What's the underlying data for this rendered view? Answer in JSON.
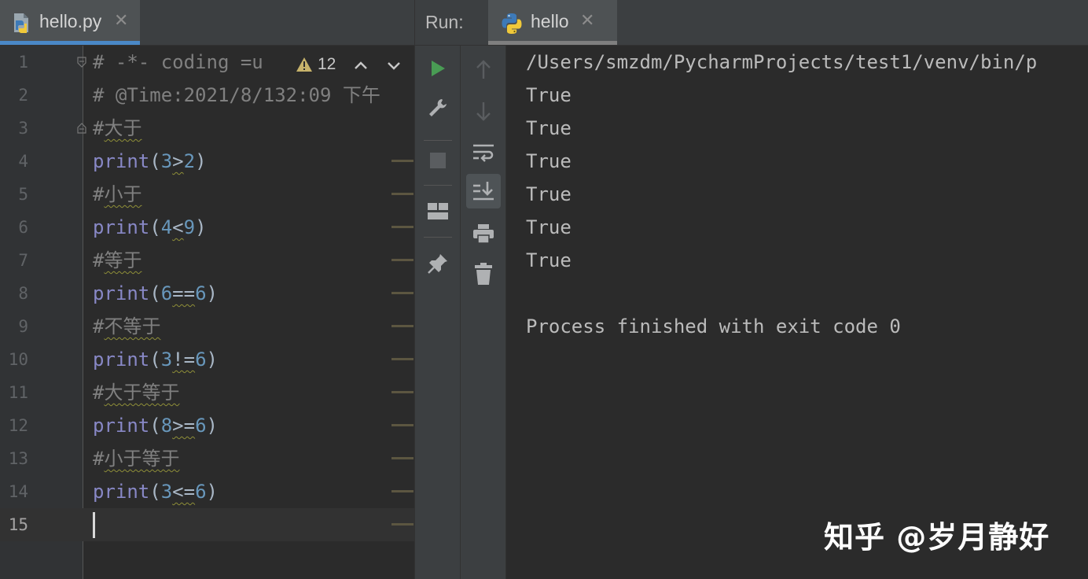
{
  "editor": {
    "tab": {
      "label": "hello.py",
      "close": "✕"
    },
    "inspection": {
      "warning_count": "12"
    },
    "line_numbers": [
      "1",
      "2",
      "3",
      "4",
      "5",
      "6",
      "7",
      "8",
      "9",
      "10",
      "11",
      "12",
      "13",
      "14",
      "15"
    ],
    "active_line": "15",
    "lines": [
      [
        {
          "t": "# -*- coding =u",
          "c": "comment"
        }
      ],
      [
        {
          "t": "# @Time:2021/8/132:09 下午",
          "c": "comment"
        }
      ],
      [
        {
          "t": "#",
          "c": "comment"
        },
        {
          "t": "大于",
          "c": "comment squiggle"
        }
      ],
      [
        {
          "t": "print",
          "c": "fn"
        },
        {
          "t": "(",
          "c": "paren"
        },
        {
          "t": "3",
          "c": "num"
        },
        {
          "t": ">",
          "c": "op squiggle"
        },
        {
          "t": "2",
          "c": "num"
        },
        {
          "t": ")",
          "c": "paren"
        }
      ],
      [
        {
          "t": "#",
          "c": "comment"
        },
        {
          "t": "小于",
          "c": "comment squiggle"
        }
      ],
      [
        {
          "t": "print",
          "c": "fn"
        },
        {
          "t": "(",
          "c": "paren"
        },
        {
          "t": "4",
          "c": "num"
        },
        {
          "t": "<",
          "c": "op squiggle"
        },
        {
          "t": "9",
          "c": "num"
        },
        {
          "t": ")",
          "c": "paren"
        }
      ],
      [
        {
          "t": "#",
          "c": "comment"
        },
        {
          "t": "等于",
          "c": "comment squiggle"
        }
      ],
      [
        {
          "t": "print",
          "c": "fn"
        },
        {
          "t": "(",
          "c": "paren"
        },
        {
          "t": "6",
          "c": "num"
        },
        {
          "t": "==",
          "c": "op squiggle"
        },
        {
          "t": "6",
          "c": "num"
        },
        {
          "t": ")",
          "c": "paren"
        }
      ],
      [
        {
          "t": "#",
          "c": "comment"
        },
        {
          "t": "不等于",
          "c": "comment squiggle"
        }
      ],
      [
        {
          "t": "print",
          "c": "fn"
        },
        {
          "t": "(",
          "c": "paren"
        },
        {
          "t": "3",
          "c": "num"
        },
        {
          "t": "!=",
          "c": "op squiggle"
        },
        {
          "t": "6",
          "c": "num"
        },
        {
          "t": ")",
          "c": "paren"
        }
      ],
      [
        {
          "t": "#",
          "c": "comment"
        },
        {
          "t": "大于等于",
          "c": "comment squiggle"
        }
      ],
      [
        {
          "t": "print",
          "c": "fn"
        },
        {
          "t": "(",
          "c": "paren"
        },
        {
          "t": "8",
          "c": "num"
        },
        {
          "t": ">=",
          "c": "op squiggle"
        },
        {
          "t": "6",
          "c": "num"
        },
        {
          "t": ")",
          "c": "paren"
        }
      ],
      [
        {
          "t": "#",
          "c": "comment"
        },
        {
          "t": "小于等于",
          "c": "comment squiggle"
        }
      ],
      [
        {
          "t": "print",
          "c": "fn"
        },
        {
          "t": "(",
          "c": "paren"
        },
        {
          "t": "3",
          "c": "num"
        },
        {
          "t": "<=",
          "c": "op squiggle"
        },
        {
          "t": "6",
          "c": "num"
        },
        {
          "t": ")",
          "c": "paren"
        }
      ],
      []
    ]
  },
  "run": {
    "label": "Run:",
    "tab": {
      "label": "hello",
      "close": "✕"
    },
    "toolbar_left": [
      "run-icon",
      "wrench-icon",
      "stop-icon",
      "layout-icon",
      "pin-icon"
    ],
    "toolbar_right": [
      "arrow-up-icon",
      "arrow-down-icon",
      "soft-wrap-icon",
      "scroll-to-end-icon",
      "print-icon",
      "trash-icon"
    ],
    "console": [
      "/Users/smzdm/PycharmProjects/test1/venv/bin/p",
      "True",
      "True",
      "True",
      "True",
      "True",
      "True",
      "",
      "Process finished with exit code 0"
    ]
  },
  "watermark": "知乎 @岁月静好",
  "colors": {
    "accent": "#4a88c7",
    "run_green": "#499c54",
    "comment": "#808080",
    "function": "#8888c6",
    "number": "#6897bb"
  }
}
